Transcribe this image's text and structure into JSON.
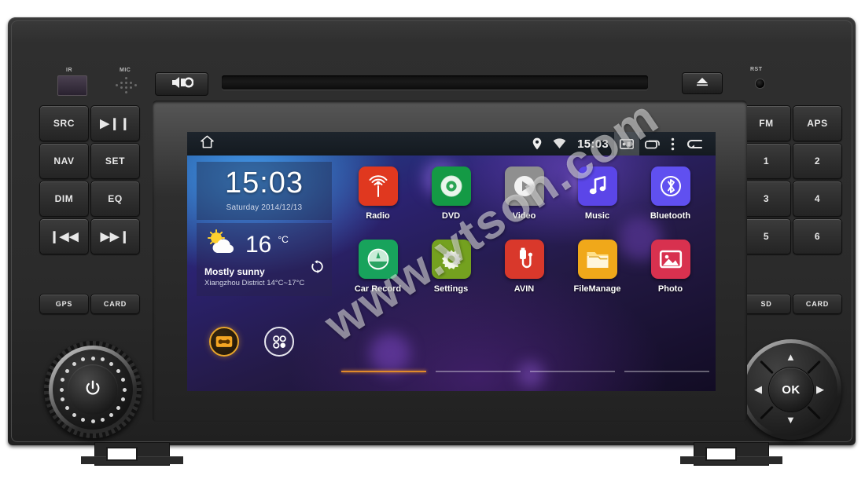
{
  "device": {
    "labels": {
      "ir": "IR",
      "mic": "MIC",
      "rst": "RST"
    },
    "mute_icon": "speaker-mute-icon",
    "eject_icon": "eject-icon",
    "disc_slot": "disc-slot"
  },
  "left_panel": {
    "buttons": [
      {
        "label": "SRC",
        "name": "src-button",
        "glyph": false
      },
      {
        "label": "▶❙❙",
        "name": "play-pause-button",
        "glyph": true
      },
      {
        "label": "NAV",
        "name": "nav-button",
        "glyph": false
      },
      {
        "label": "SET",
        "name": "set-button",
        "glyph": false
      },
      {
        "label": "DIM",
        "name": "dim-button",
        "glyph": false
      },
      {
        "label": "EQ",
        "name": "eq-button",
        "glyph": false
      },
      {
        "label": "❙◀◀",
        "name": "previous-track-button",
        "glyph": true
      },
      {
        "label": "▶▶❙",
        "name": "next-track-button",
        "glyph": true
      }
    ],
    "small_buttons": [
      {
        "label": "GPS",
        "name": "gps-button"
      },
      {
        "label": "CARD",
        "name": "card-button"
      }
    ],
    "knob": {
      "name": "volume-power-knob",
      "center_icon": "power-icon"
    }
  },
  "right_panel": {
    "buttons": [
      {
        "label": "FM",
        "name": "fm-button",
        "glyph": false
      },
      {
        "label": "APS",
        "name": "aps-button",
        "glyph": false
      },
      {
        "label": "1",
        "name": "preset-1-button",
        "glyph": false
      },
      {
        "label": "2",
        "name": "preset-2-button",
        "glyph": false
      },
      {
        "label": "3",
        "name": "preset-3-button",
        "glyph": false
      },
      {
        "label": "4",
        "name": "preset-4-button",
        "glyph": false
      },
      {
        "label": "5",
        "name": "preset-5-button",
        "glyph": false
      },
      {
        "label": "6",
        "name": "preset-6-button",
        "glyph": false
      }
    ],
    "small_buttons": [
      {
        "label": "SD",
        "name": "sd-button"
      },
      {
        "label": "CARD",
        "name": "card-slot-button"
      }
    ],
    "dpad": {
      "ok_label": "OK",
      "up": "▲",
      "down": "▼",
      "left": "◀",
      "right": "▶"
    }
  },
  "screen": {
    "status_bar": {
      "home_icon": "home-icon",
      "location_icon": "location-pin-icon",
      "wifi_icon": "wifi-icon",
      "clock": "15:03",
      "screenshot_icon": "screenshot-icon",
      "recents_icon": "recent-apps-icon",
      "overflow_icon": "overflow-menu-icon",
      "back_icon": "back-icon"
    },
    "clock_widget": {
      "time": "15:03",
      "date": "Saturday 2014/12/13"
    },
    "weather_widget": {
      "icon": "sun-behind-cloud-icon",
      "temperature": "16",
      "unit": "°C",
      "condition": "Mostly sunny",
      "location_range": "Xiangzhou District 14°C~17°C",
      "refresh_icon": "refresh-icon"
    },
    "dock": [
      {
        "name": "dock-radio-icon",
        "icon": "car-radio-icon"
      },
      {
        "name": "dock-app-drawer-icon",
        "icon": "app-drawer-icon"
      }
    ],
    "apps_row1": [
      {
        "label": "Radio",
        "name": "app-radio",
        "icon": "radio-tower-icon",
        "color": "#e0381f"
      },
      {
        "label": "DVD",
        "name": "app-dvd",
        "icon": "disc-icon",
        "color": "#149a45"
      },
      {
        "label": "Video",
        "name": "app-video",
        "icon": "play-circle-icon",
        "color": "#8f8f8f"
      },
      {
        "label": "Music",
        "name": "app-music",
        "icon": "music-note-icon",
        "color": "#5b46e8"
      },
      {
        "label": "Bluetooth",
        "name": "app-bluetooth",
        "icon": "bluetooth-icon",
        "color": "#6050f0"
      }
    ],
    "apps_row2": [
      {
        "label": "Car Record",
        "name": "app-car-record",
        "icon": "dashcam-icon",
        "color": "#18a35c"
      },
      {
        "label": "Settings",
        "name": "app-settings",
        "icon": "gear-icon",
        "color": "#74a11f"
      },
      {
        "label": "AVIN",
        "name": "app-avin",
        "icon": "av-input-icon",
        "color": "#d9382b"
      },
      {
        "label": "FileManage",
        "name": "app-file-manager",
        "icon": "folder-icon",
        "color": "#f0a81a"
      },
      {
        "label": "Photo",
        "name": "app-photo",
        "icon": "photo-image-icon",
        "color": "#d8314f"
      }
    ],
    "page_indicator": {
      "pages": 4,
      "active": 1
    }
  },
  "watermark": {
    "text": "www.vtson.com"
  }
}
